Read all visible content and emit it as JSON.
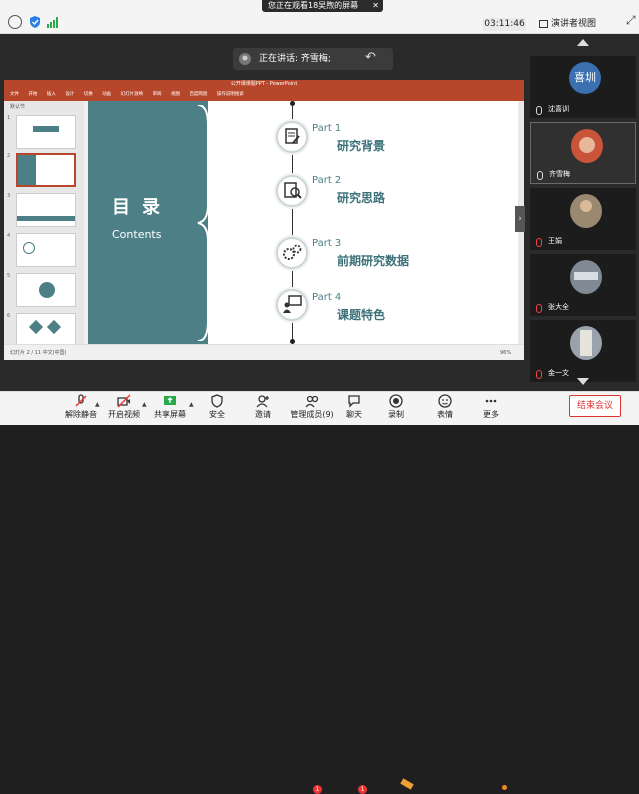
{
  "banner": {
    "text": "您正在观看18吴煦的屏幕"
  },
  "timer": "03:11:46",
  "view_mode": "演讲者视图",
  "speaking": {
    "text": "正在讲话: 齐雪梅;"
  },
  "ppt": {
    "window_title": "公开课课题PPT - PowerPoint",
    "ribbon_tabs": [
      "文件",
      "开始",
      "插入",
      "设计",
      "切换",
      "动画",
      "幻灯片放映",
      "审阅",
      "视图",
      "百度网盘",
      "操作说明搜索"
    ],
    "status": "幻灯片 2 / 11  中文(中国)",
    "zoom": "96%",
    "section_label": "默认节",
    "thumb_numbers": [
      "1",
      "2",
      "3",
      "4",
      "5",
      "6"
    ]
  },
  "slide": {
    "heading": "目录",
    "subheading": "Contents",
    "parts": [
      {
        "num": "Part 1",
        "title": "研究背景"
      },
      {
        "num": "Part 2",
        "title": "研究思路"
      },
      {
        "num": "Part 3",
        "title": "前期研究数据"
      },
      {
        "num": "Part 4",
        "title": "课题特色"
      }
    ]
  },
  "participants": [
    {
      "name": "沈喜训",
      "avatar_text": "喜圳",
      "avatar_color": "#3a6fb0"
    },
    {
      "name": "齐雪梅",
      "avatar_text": "",
      "avatar_color": "#c9543a"
    },
    {
      "name": "王娟",
      "avatar_text": "",
      "avatar_color": "#9a8870"
    },
    {
      "name": "张大全",
      "avatar_text": "",
      "avatar_color": "#7f8a94"
    },
    {
      "name": "金一文",
      "avatar_text": "",
      "avatar_color": "#9aa3ad"
    }
  ],
  "toolbar": {
    "items": [
      {
        "label": "解除静音",
        "icon": "mic-muted-icon"
      },
      {
        "label": "开启视频",
        "icon": "video-off-icon"
      },
      {
        "label": "共享屏幕",
        "icon": "share-screen-icon"
      },
      {
        "label": "安全",
        "icon": "shield-icon"
      },
      {
        "label": "邀请",
        "icon": "invite-icon"
      },
      {
        "label": "管理成员(9)",
        "icon": "members-icon"
      },
      {
        "label": "聊天",
        "icon": "chat-icon"
      },
      {
        "label": "录制",
        "icon": "record-icon"
      },
      {
        "label": "表情",
        "icon": "emoji-icon"
      },
      {
        "label": "更多",
        "icon": "more-icon"
      }
    ],
    "badges": {
      "members": "1",
      "chat": "1"
    },
    "end_label": "结束会议"
  },
  "colors": {
    "accent_teal": "#4d7f86",
    "ppt_red": "#b7472a",
    "end_red": "#dd3333"
  }
}
